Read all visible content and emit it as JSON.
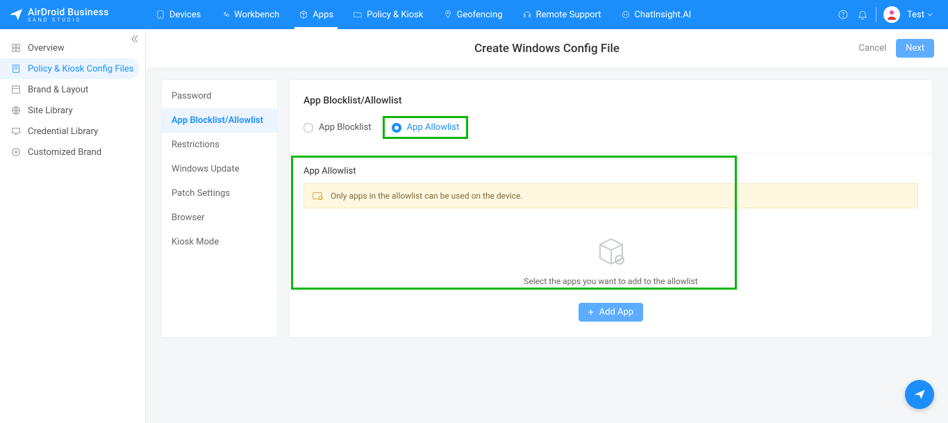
{
  "brand": {
    "name": "AirDroid Business",
    "subtitle": "SAND STUDIO"
  },
  "nav": {
    "items": [
      {
        "label": "Devices"
      },
      {
        "label": "Workbench"
      },
      {
        "label": "Apps"
      },
      {
        "label": "Policy & Kiosk"
      },
      {
        "label": "Geofencing"
      },
      {
        "label": "Remote Support"
      },
      {
        "label": "ChatInsight.AI"
      }
    ],
    "user": "Test"
  },
  "sidebar": {
    "items": [
      {
        "label": "Overview"
      },
      {
        "label": "Policy & Kiosk Config Files"
      },
      {
        "label": "Brand & Layout"
      },
      {
        "label": "Site Library"
      },
      {
        "label": "Credential Library"
      },
      {
        "label": "Customized Brand"
      }
    ]
  },
  "page": {
    "title": "Create Windows Config File",
    "cancel": "Cancel",
    "next": "Next"
  },
  "configTabs": [
    {
      "label": "Password"
    },
    {
      "label": "App Blocklist/Allowlist"
    },
    {
      "label": "Restrictions"
    },
    {
      "label": "Windows Update"
    },
    {
      "label": "Patch Settings"
    },
    {
      "label": "Browser"
    },
    {
      "label": "Kiosk Mode"
    }
  ],
  "panel": {
    "sectionTitle": "App Blocklist/Allowlist",
    "radios": {
      "blocklist": "App Blocklist",
      "allowlist": "App Allowlist"
    },
    "subTitle": "App Allowlist",
    "infoText": "Only apps in the allowlist can be used on the device.",
    "emptyText": "Select the apps you want to add to the allowlist",
    "addApp": "Add App"
  }
}
